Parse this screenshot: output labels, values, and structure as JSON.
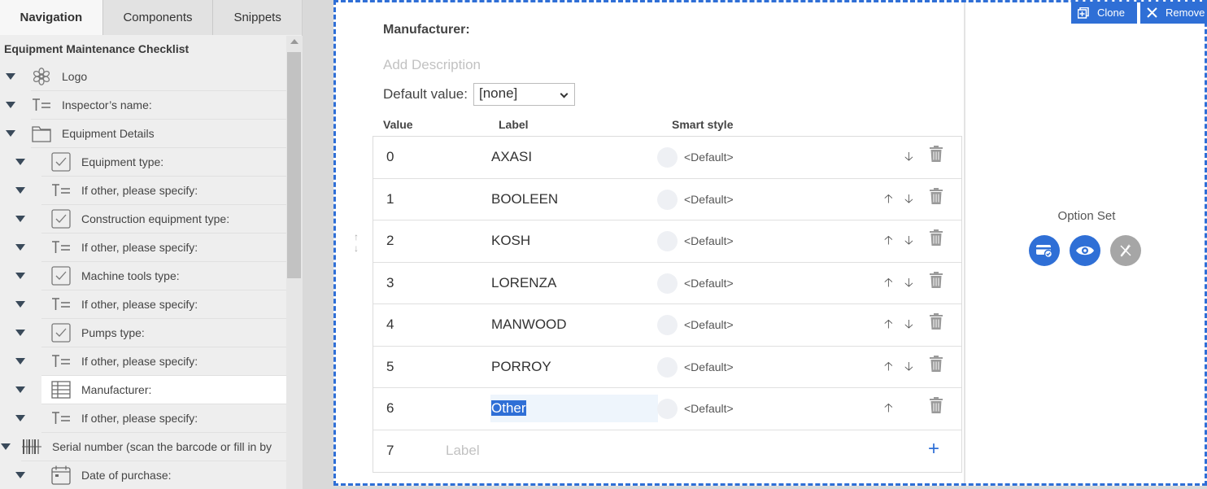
{
  "tabs": [
    {
      "label": "Navigation",
      "active": true
    },
    {
      "label": "Components",
      "active": false
    },
    {
      "label": "Snippets",
      "active": false
    }
  ],
  "tree": {
    "title": "Equipment Maintenance Checklist",
    "items": [
      {
        "label": "Logo",
        "icon": "gear-flower-icon",
        "level": 0
      },
      {
        "label": "Inspector’s name:",
        "icon": "text-field-icon",
        "level": 0
      },
      {
        "label": "Equipment Details",
        "icon": "folder-icon",
        "level": 0
      },
      {
        "label": "Equipment type:",
        "icon": "checkbox-icon",
        "level": 1
      },
      {
        "label": "If other, please specify:",
        "icon": "text-field-icon",
        "level": 1
      },
      {
        "label": "Construction equipment type:",
        "icon": "checkbox-icon",
        "level": 1
      },
      {
        "label": "If other, please specify:",
        "icon": "text-field-icon",
        "level": 1
      },
      {
        "label": "Machine tools type:",
        "icon": "checkbox-icon",
        "level": 1
      },
      {
        "label": "If other, please specify:",
        "icon": "text-field-icon",
        "level": 1
      },
      {
        "label": "Pumps type:",
        "icon": "checkbox-icon",
        "level": 1
      },
      {
        "label": "If other, please specify:",
        "icon": "text-field-icon",
        "level": 1
      },
      {
        "label": "Manufacturer:",
        "icon": "table-icon",
        "level": 1,
        "selected": true
      },
      {
        "label": "If other, please specify:",
        "icon": "text-field-icon",
        "level": 1
      },
      {
        "label": "Serial number (scan the barcode or fill in by",
        "icon": "barcode-icon",
        "level": 0
      },
      {
        "label": "Date of purchase:",
        "icon": "calendar-icon",
        "level": 1
      }
    ]
  },
  "editor": {
    "field_label": "Manufacturer:",
    "description_placeholder": "Add Description",
    "default_label": "Default value:",
    "default_value": "[none]",
    "columns": {
      "value": "Value",
      "label": "Label",
      "smart_style": "Smart style"
    },
    "rows": [
      {
        "value": "0",
        "label": "AXASI",
        "style": "<Default>",
        "up": false,
        "down": true
      },
      {
        "value": "1",
        "label": "BOOLEEN",
        "style": "<Default>",
        "up": true,
        "down": true
      },
      {
        "value": "2",
        "label": "KOSH",
        "style": "<Default>",
        "up": true,
        "down": true
      },
      {
        "value": "3",
        "label": "LORENZA",
        "style": "<Default>",
        "up": true,
        "down": true
      },
      {
        "value": "4",
        "label": "MANWOOD",
        "style": "<Default>",
        "up": true,
        "down": true
      },
      {
        "value": "5",
        "label": "PORROY",
        "style": "<Default>",
        "up": true,
        "down": true
      },
      {
        "value": "6",
        "label": "Other",
        "style": "<Default>",
        "up": true,
        "down": false,
        "editing": true
      }
    ],
    "new_row": {
      "value": "7",
      "label_placeholder": "Label"
    },
    "side_title": "Option Set",
    "clone_label": "Clone",
    "remove_label": "Remove"
  },
  "colors": {
    "accent": "#2f6fd6",
    "selection": "#2f6fd6"
  }
}
